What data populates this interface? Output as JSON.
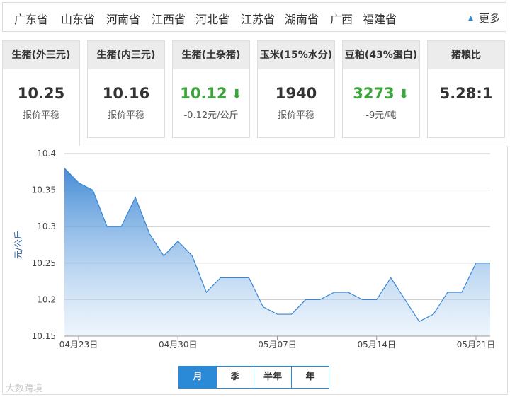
{
  "regions": [
    "广东省",
    "山东省",
    "河南省",
    "江西省",
    "河北省",
    "江苏省",
    "湖南省",
    "广西",
    "福建省"
  ],
  "more_label": "更多",
  "cards": [
    {
      "title": "生猪(外三元)",
      "value": "10.25",
      "sub": "报价平稳",
      "trend": "flat"
    },
    {
      "title": "生猪(内三元)",
      "value": "10.16",
      "sub": "报价平稳",
      "trend": "flat"
    },
    {
      "title": "生猪(土杂猪)",
      "value": "10.12",
      "sub": "-0.12元/公斤",
      "trend": "down"
    },
    {
      "title": "玉米(15%水分)",
      "value": "1940",
      "sub": "报价平稳",
      "trend": "flat"
    },
    {
      "title": "豆粕(43%蛋白)",
      "value": "3273",
      "sub": "-9元/吨",
      "trend": "down"
    },
    {
      "title": "猪粮比",
      "value": "5.28:1",
      "sub": "",
      "trend": "flat"
    }
  ],
  "down_color": "#3aa53a",
  "accent_color": "#2a8ad8",
  "chart_data": {
    "type": "area",
    "ylabel": "元/公斤",
    "ylim": [
      10.15,
      10.4
    ],
    "yticks": [
      "10.15",
      "10.2",
      "10.25",
      "10.3",
      "10.35",
      "10.4"
    ],
    "xticks": [
      {
        "label": "04月23日",
        "index": 1
      },
      {
        "label": "04月30日",
        "index": 8
      },
      {
        "label": "05月07日",
        "index": 15
      },
      {
        "label": "05月14日",
        "index": 22
      },
      {
        "label": "05月21日",
        "index": 29
      }
    ],
    "values": [
      10.38,
      10.36,
      10.35,
      10.3,
      10.3,
      10.34,
      10.29,
      10.26,
      10.28,
      10.26,
      10.21,
      10.23,
      10.23,
      10.23,
      10.19,
      10.18,
      10.18,
      10.2,
      10.2,
      10.21,
      10.21,
      10.2,
      10.2,
      10.23,
      10.2,
      10.17,
      10.18,
      10.21,
      10.21,
      10.25,
      10.25
    ],
    "grid": true,
    "line_color": "#3a86d4"
  },
  "periods": [
    "月",
    "季",
    "半年",
    "年"
  ],
  "active_period": "月",
  "watermark": "大数跨境"
}
